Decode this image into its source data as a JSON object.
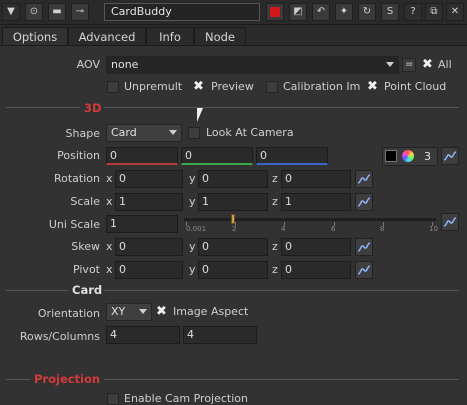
{
  "node_name": "CardBuddy",
  "tabs": [
    "Options",
    "Advanced",
    "Info",
    "Node"
  ],
  "aov": {
    "label": "AOV",
    "value": "none",
    "eq_label": "=",
    "all_label": "All"
  },
  "checks": {
    "unpremult": "Unpremult",
    "preview": "Preview",
    "calibration": "Calibration Im",
    "point_cloud": "Point Cloud"
  },
  "section_3d": "3D",
  "shape": {
    "label": "Shape",
    "value": "Card",
    "look_at_camera": "Look At Camera"
  },
  "position": {
    "label": "Position",
    "values": [
      "0",
      "0",
      "0"
    ],
    "count": "3"
  },
  "rotation": {
    "label": "Rotation",
    "x": "0",
    "y": "0",
    "z": "0"
  },
  "scale": {
    "label": "Scale",
    "x": "1",
    "y": "1",
    "z": "1"
  },
  "uni_scale": {
    "label": "Uni Scale",
    "value": "1",
    "ticks": [
      "0.001",
      "2",
      "4",
      "6",
      "8",
      "10"
    ],
    "slider_value": 1
  },
  "skew": {
    "label": "Skew",
    "x": "0",
    "y": "0",
    "z": "0"
  },
  "pivot": {
    "label": "Pivot",
    "x": "0",
    "y": "0",
    "z": "0"
  },
  "axis_labels": {
    "x": "x",
    "y": "y",
    "z": "z"
  },
  "section_card": "Card",
  "orientation": {
    "label": "Orientation",
    "value": "XY",
    "image_aspect": "Image Aspect"
  },
  "rows_columns": {
    "label": "Rows/Columns",
    "rows": "4",
    "cols": "4"
  },
  "section_projection": "Projection",
  "enable_cam_projection": "Enable Cam Projection",
  "colors": {
    "accent_red": "#d33a3a",
    "panel": "#323232",
    "field": "#2a2a2a"
  }
}
